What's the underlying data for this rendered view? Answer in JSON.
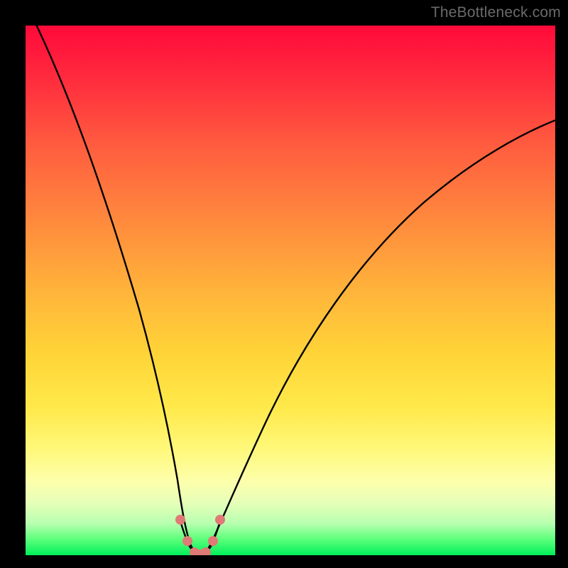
{
  "watermark": "TheBottleneck.com",
  "colors": {
    "background": "#000000",
    "gradient_top": "#ff0a3a",
    "gradient_bottom": "#00ef5b",
    "curve": "#000000",
    "marker": "#e07a76"
  },
  "chart_data": {
    "type": "line",
    "title": "",
    "xlabel": "",
    "ylabel": "",
    "xlim": [
      0,
      100
    ],
    "ylim": [
      0,
      100
    ],
    "series": [
      {
        "name": "bottleneck-curve",
        "x": [
          0,
          5,
          10,
          15,
          20,
          23,
          25,
          27,
          28,
          29,
          30,
          31,
          32,
          33,
          34,
          35,
          38,
          42,
          48,
          55,
          63,
          72,
          82,
          92,
          100
        ],
        "y": [
          103,
          85,
          67,
          49,
          31,
          20,
          12,
          6,
          3.5,
          2,
          1.5,
          1.5,
          2,
          3.5,
          6,
          9,
          18,
          28,
          40,
          51,
          60,
          67,
          73,
          77,
          80
        ]
      }
    ],
    "markers": {
      "name": "bottom-u-marker",
      "color": "#e07a76",
      "points_xy": [
        [
          26.5,
          7.5
        ],
        [
          28.0,
          3.5
        ],
        [
          29.0,
          2.0
        ],
        [
          30.0,
          1.5
        ],
        [
          31.0,
          1.5
        ],
        [
          32.0,
          2.0
        ],
        [
          33.0,
          3.5
        ],
        [
          34.5,
          7.5
        ]
      ]
    }
  }
}
